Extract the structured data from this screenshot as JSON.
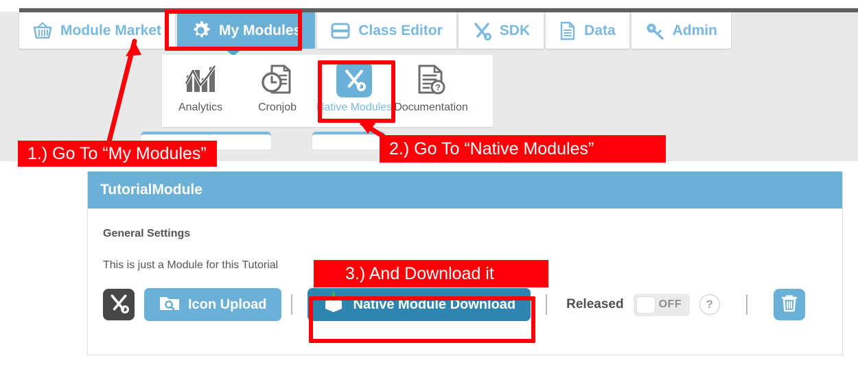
{
  "nav": {
    "tabs": [
      {
        "label": "Module Market",
        "icon": "basket-icon",
        "active": false
      },
      {
        "label": "My Modules",
        "icon": "gear-icon",
        "active": true
      },
      {
        "label": "Class Editor",
        "icon": "rows-icon",
        "active": false
      },
      {
        "label": "SDK",
        "icon": "tools-icon",
        "active": false
      },
      {
        "label": "Data",
        "icon": "document-icon",
        "active": false
      },
      {
        "label": "Admin",
        "icon": "key-icon",
        "active": false
      }
    ]
  },
  "submenu": {
    "items": [
      {
        "label": "Analytics",
        "icon": "chart-icon",
        "active": false
      },
      {
        "label": "Cronjob",
        "icon": "clock-doc-icon",
        "active": false
      },
      {
        "label": "Native Modules",
        "icon": "tools-icon",
        "active": true
      },
      {
        "label": "Documentation",
        "icon": "doc-question-icon",
        "active": false
      }
    ]
  },
  "panel": {
    "title": "TutorialModule",
    "section_title": "General Settings",
    "description": "This is just a Module for this Tutorial",
    "actions": {
      "module_icon": "tools-icon",
      "icon_upload_label": "Icon Upload",
      "icon_upload_icon": "folder-search-icon",
      "download_label": "Native Module Download",
      "download_icon": "package-download-icon",
      "released_label": "Released",
      "toggle_state": "OFF",
      "help_label": "?",
      "delete_icon": "trash-icon"
    }
  },
  "annotations": {
    "step1": "1.) Go To “My Modules”",
    "step2": "2.) Go To “Native Modules”",
    "step3": "3.) And Download it"
  },
  "colors": {
    "accent": "#6bb0d6",
    "accent_dark": "#2e86b0",
    "annotation": "#fb0007",
    "page_bg": "#e9e9e9"
  }
}
